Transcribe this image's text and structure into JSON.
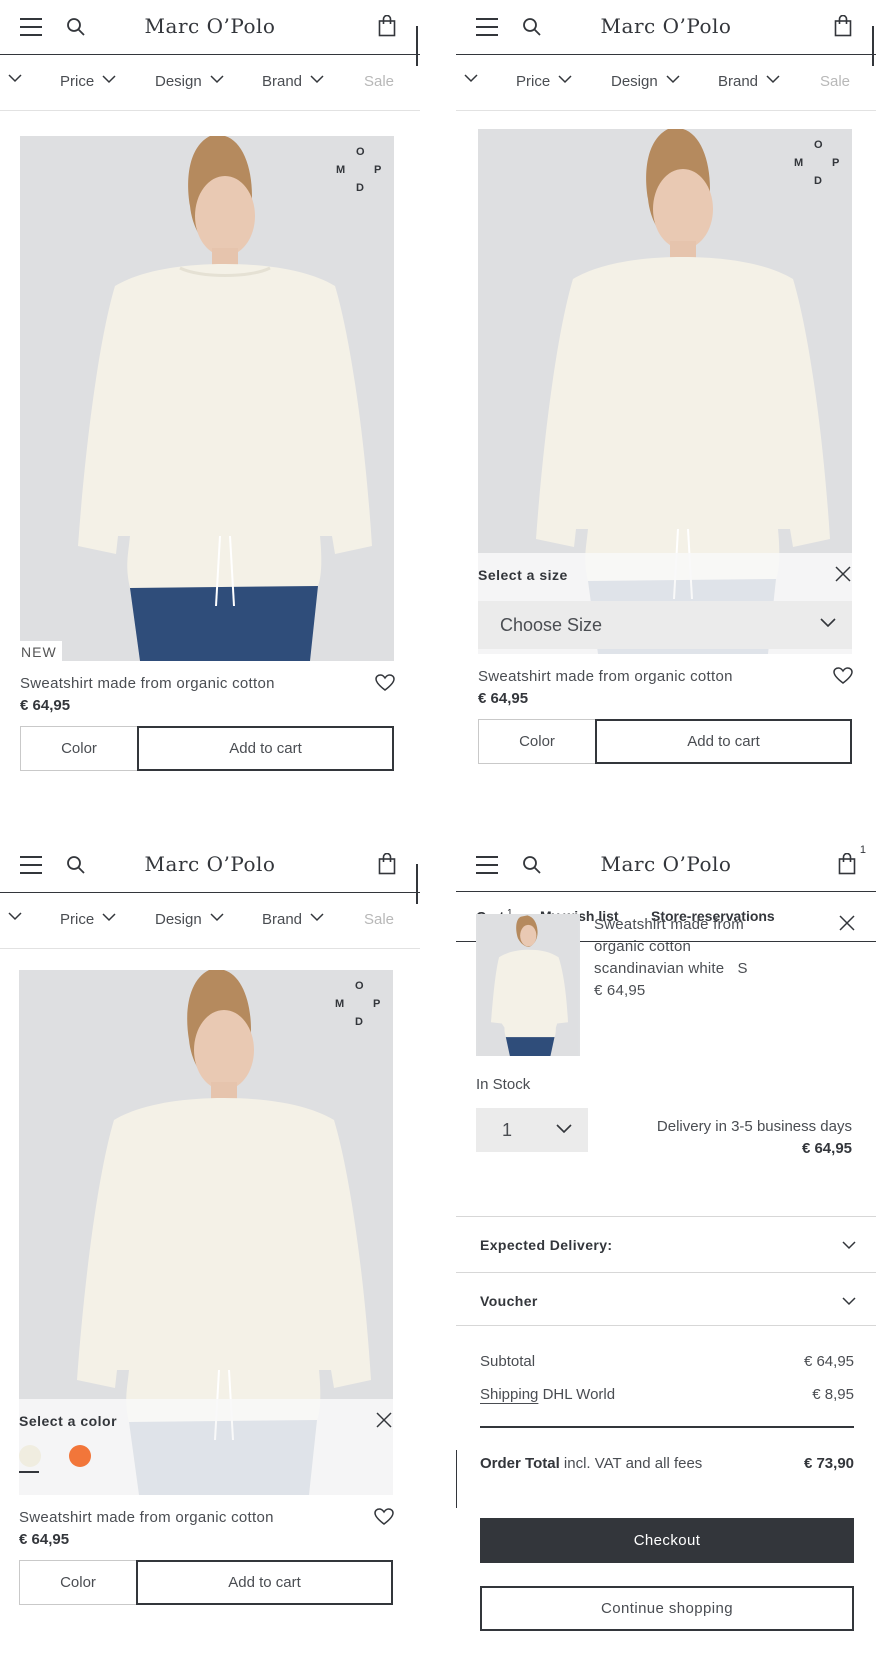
{
  "header": {
    "logo": "Marc O’Polo",
    "cart_count": "1"
  },
  "filters": {
    "price": "Price",
    "design": "Design",
    "brand": "Brand",
    "sale": "Sale"
  },
  "brand_mark": {
    "m": "M",
    "o": "O",
    "p": "P",
    "d": "D"
  },
  "product": {
    "badge": "NEW",
    "name": "Sweatshirt made from organic cotton",
    "price": "€ 64,95",
    "color_button": "Color",
    "cart_button": "Add to cart"
  },
  "size_overlay": {
    "title": "Select a size",
    "placeholder": "Choose Size"
  },
  "color_overlay": {
    "title": "Select a color",
    "swatches": [
      {
        "name": "scandinavian white",
        "color": "#f0ede0"
      },
      {
        "name": "orange",
        "color": "#f2763a"
      }
    ]
  },
  "cart": {
    "tabs": {
      "cart": "Cart",
      "cart_count": "1",
      "wishlist": "My wish list",
      "store": "Store-reservations"
    },
    "item": {
      "name": "Sweatshirt made from organic cotton",
      "color_size": "scandinavian white   S",
      "price": "€ 64,95",
      "stock": "In Stock",
      "qty": "1",
      "delivery": "Delivery in 3-5 business days",
      "line_total": "€ 64,95"
    },
    "expected_delivery": "Expected Delivery:",
    "voucher": "Voucher",
    "subtotal_label": "Subtotal",
    "subtotal": "€ 64,95",
    "shipping_label": "Shipping",
    "shipping_method": "DHL World",
    "shipping": "€ 8,95",
    "order_total_label": "Order Total",
    "order_total_note": "incl. VAT and all fees",
    "order_total": "€ 73,90",
    "checkout": "Checkout",
    "continue": "Continue shopping"
  },
  "colors": {
    "text": "#33363b",
    "image_bg": "#dedfe1",
    "accent_orange": "#f2763a"
  }
}
